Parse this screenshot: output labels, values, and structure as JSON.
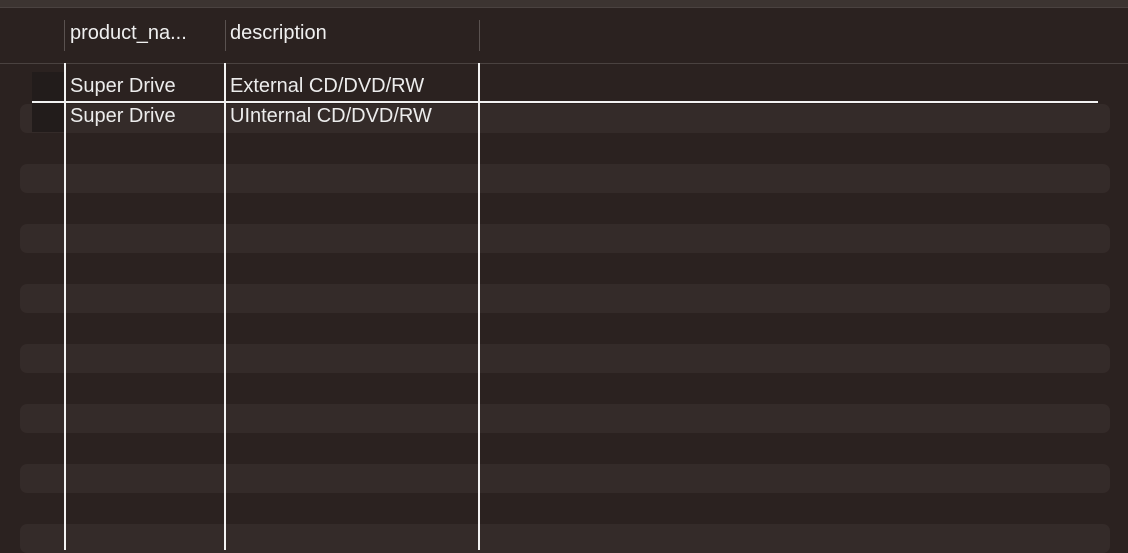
{
  "table": {
    "columns": [
      {
        "label": "product_na..."
      },
      {
        "label": "description"
      }
    ],
    "rows": [
      {
        "product_name": "Super Drive",
        "description": "External CD/DVD/RW"
      },
      {
        "product_name": "Super Drive",
        "description": "UInternal CD/DVD/RW"
      }
    ]
  },
  "colors": {
    "background": "#2b2220",
    "stripe": "#342b29",
    "grid_line": "#f2f2f2"
  }
}
